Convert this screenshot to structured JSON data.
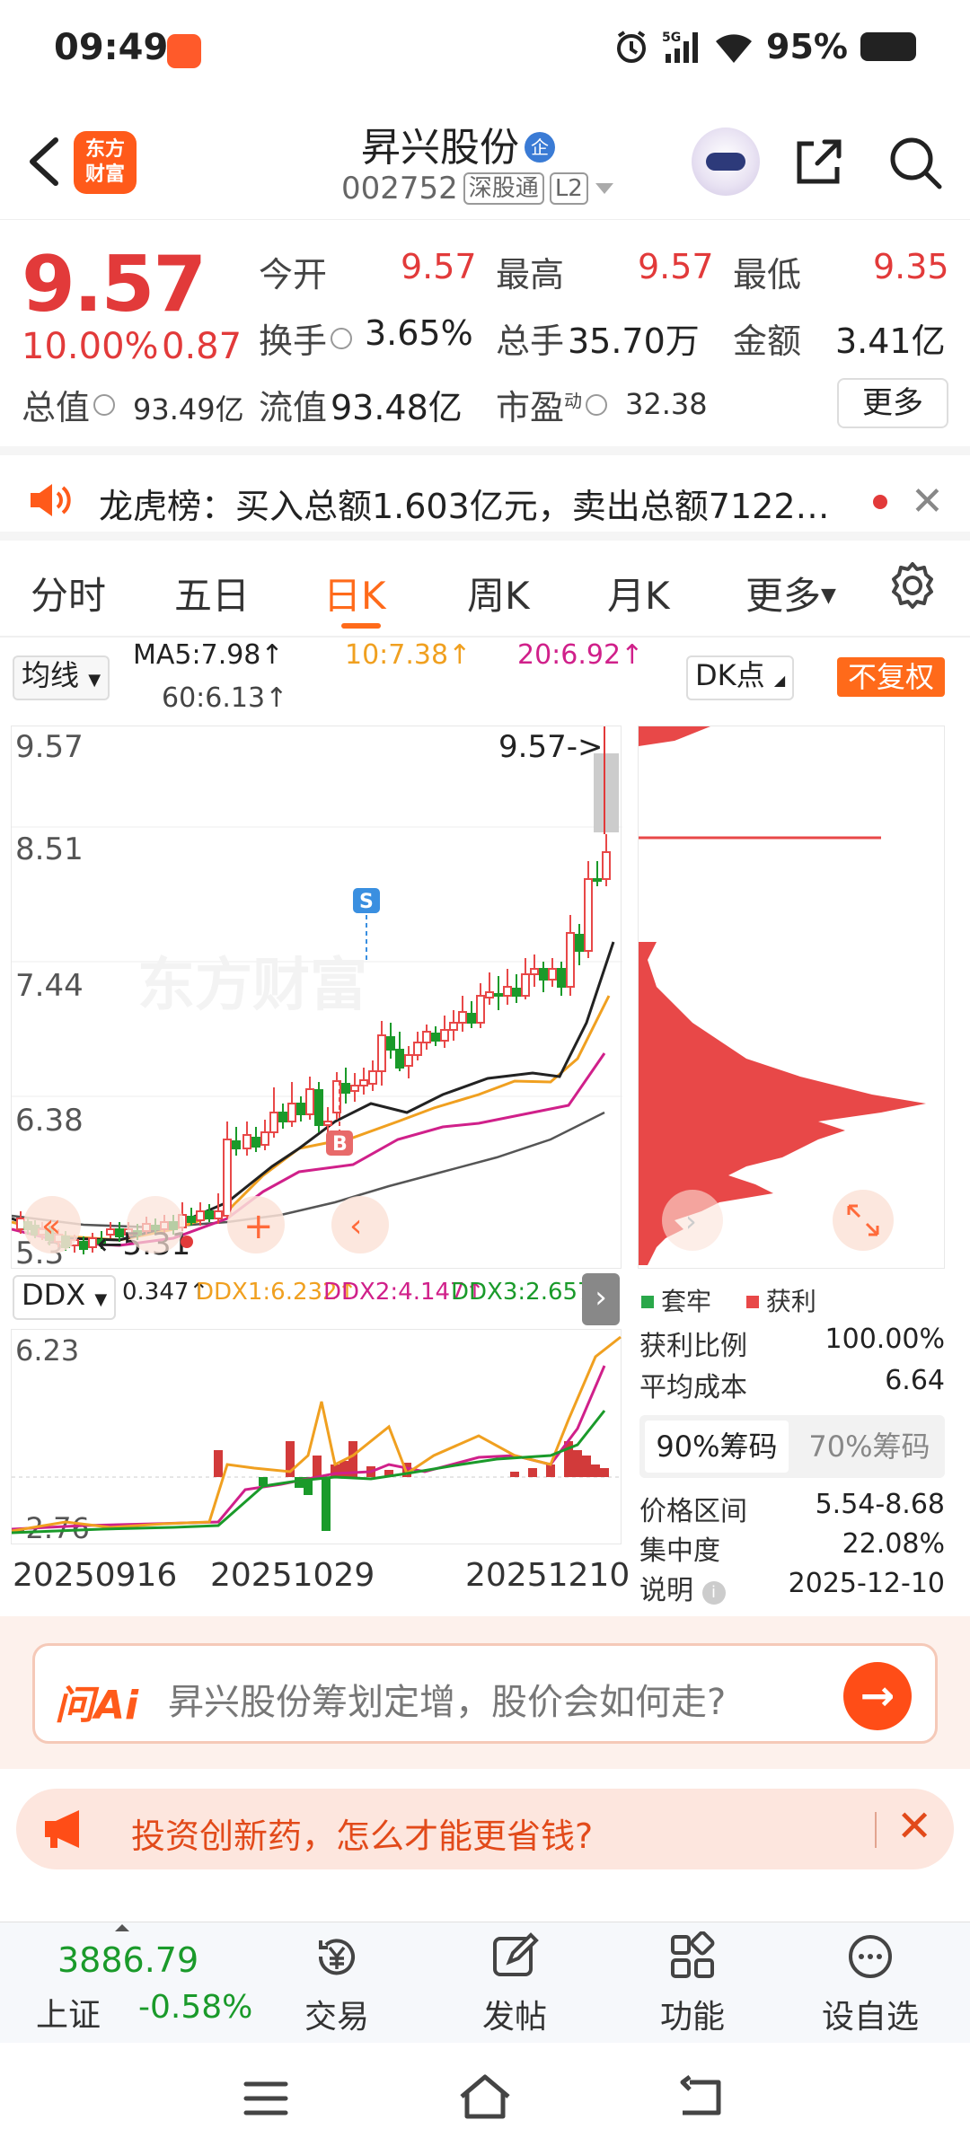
{
  "status_bar": {
    "time": "09:49",
    "network": "5G",
    "battery": "95%"
  },
  "header": {
    "logo_line1": "东方",
    "logo_line2": "财富",
    "stock_name": "昇兴股份",
    "name_badge": "企",
    "stock_code": "002752",
    "tag_connect": "深股通",
    "tag_level": "L2"
  },
  "quote": {
    "price": "9.57",
    "change_pct": "10.00%",
    "change_abs": "0.87",
    "open_label": "今开",
    "open_value": "9.57",
    "high_label": "最高",
    "high_value": "9.57",
    "low_label": "最低",
    "low_value": "9.35",
    "turnover_label": "换手",
    "turnover_value": "3.65%",
    "volume_label": "总手",
    "volume_value": "35.70万",
    "amount_label": "金额",
    "amount_value": "3.41亿",
    "total_cap_label": "总值",
    "total_cap_value": "93.49亿",
    "float_cap_label": "流值",
    "float_cap_value": "93.48亿",
    "pe_label": "市盈",
    "pe_sup": "动",
    "pe_value": "32.38",
    "more_label": "更多"
  },
  "dragon_tiger": {
    "text": "龙虎榜：买入总额1.603亿元，卖出总额7122万..."
  },
  "tabs": [
    {
      "label": "分时"
    },
    {
      "label": "五日"
    },
    {
      "label": "日K"
    },
    {
      "label": "周K"
    },
    {
      "label": "月K"
    },
    {
      "label": "更多"
    }
  ],
  "ma_row": {
    "dropdown": "均线",
    "ma5": "MA5:7.98",
    "ma10": "10:7.38",
    "ma20": "20:6.92",
    "ma60": "60:6.13",
    "dk_label": "DK点",
    "adjust_label": "不复权",
    "colors": {
      "ma5": "#222222",
      "ma10": "#f0a020",
      "ma20": "#d0208a",
      "ma60": "#555555"
    }
  },
  "kchart": {
    "price_labels": [
      "9.57",
      "8.51",
      "7.44",
      "6.38",
      "5.3"
    ],
    "current_marker": "9.57->",
    "min_marker": "5.31",
    "watermark": "东方财富",
    "sell_marker": "S",
    "buy_marker": "B"
  },
  "ddx": {
    "dropdown": "DDX",
    "ddx_value": "0.347",
    "ddx1": "DDX1:6.232",
    "ddx2": "DDX2:4.147",
    "ddx3": "DDX3:2.657",
    "top_label": "6.23",
    "bottom_label": "-2.76"
  },
  "dates": [
    "20250916",
    "20251029",
    "20251210"
  ],
  "chip_profile": {
    "legend_trapped": "套牢",
    "legend_profit": "获利",
    "profit_ratio_label": "获利比例",
    "profit_ratio_value": "100.00%",
    "avg_cost_label": "平均成本",
    "avg_cost_value": "6.64",
    "tab_90": "90%筹码",
    "tab_70": "70%筹码",
    "price_range_label": "价格区间",
    "price_range_value": "5.54-8.68",
    "concentration_label": "集中度",
    "concentration_value": "22.08%",
    "note_label": "说明",
    "note_value": "2025-12-10",
    "colors": {
      "profit": "#e84848",
      "trapped": "#2aa84a"
    }
  },
  "ai_box": {
    "logo": "问Ai",
    "placeholder": "昇兴股份筹划定增，股价会如何走?"
  },
  "promo": {
    "text": "投资创新药，怎么才能更省钱?"
  },
  "bottom_bar": {
    "index_value": "3886.79",
    "index_name": "上证",
    "index_change": "-0.58%",
    "items": [
      {
        "label": "交易",
        "icon": "yen-icon"
      },
      {
        "label": "发帖",
        "icon": "edit-icon"
      },
      {
        "label": "功能",
        "icon": "grid-icon"
      },
      {
        "label": "设自选",
        "icon": "more-icon"
      }
    ]
  }
}
